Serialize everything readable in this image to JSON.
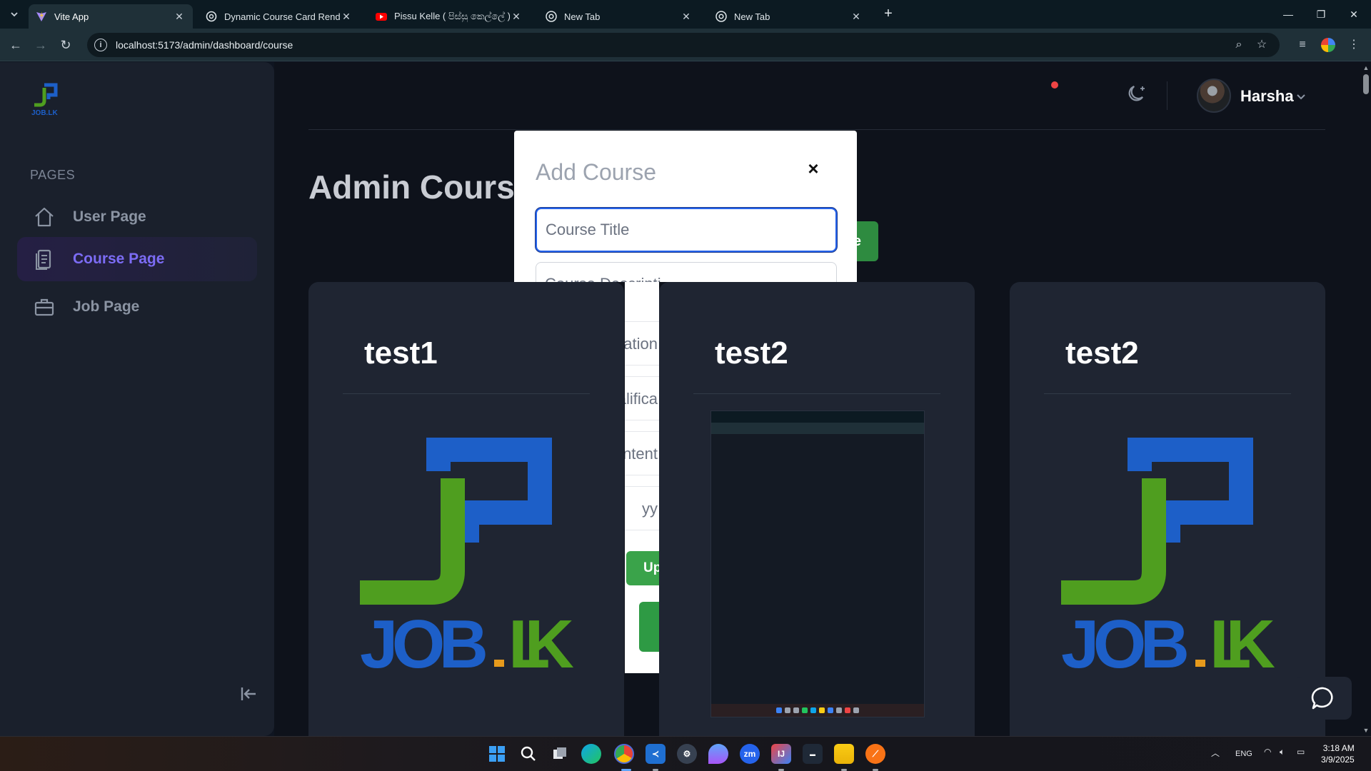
{
  "browser": {
    "tabs": [
      {
        "title": "Vite App",
        "icon": "vite-icon",
        "active": true
      },
      {
        "title": "Dynamic Course Card Renderin",
        "icon": "chatgpt-icon",
        "active": false
      },
      {
        "title": "Pissu Kelle ( පිස්සු කෙල්ලේ ) -",
        "icon": "youtube-icon",
        "active": false
      },
      {
        "title": "New Tab",
        "icon": "chrome-icon",
        "active": false
      },
      {
        "title": "New Tab",
        "icon": "chrome-icon",
        "active": false
      }
    ],
    "url": "localhost:5173/admin/dashboard/course",
    "new_tab_symbol": "+"
  },
  "sidebar": {
    "logo_text": "JOB.LK",
    "section_title": "PAGES",
    "items": [
      {
        "label": "User Page",
        "icon": "home-icon",
        "active": false
      },
      {
        "label": "Course Page",
        "icon": "document-icon",
        "active": true
      },
      {
        "label": "Job Page",
        "icon": "briefcase-icon",
        "active": false
      }
    ]
  },
  "header": {
    "user_name": "Harsha"
  },
  "main": {
    "page_title": "Admin Course",
    "add_button_label": "e",
    "cards": [
      {
        "title": "test1",
        "image": "joblk-logo"
      },
      {
        "title": "test2",
        "image": "screenshot"
      },
      {
        "title": "test2",
        "image": "joblk-logo"
      }
    ]
  },
  "modal": {
    "title": "Add Course",
    "close_symbol": "×",
    "fields": [
      {
        "placeholder": "Course Title"
      },
      {
        "placeholder": "Course Descripti"
      }
    ],
    "hidden_fields": [
      "ation",
      "alifica",
      "ntent",
      "yy"
    ],
    "upload_label": "Up"
  },
  "taskbar": {
    "language": "ENG",
    "time": "3:18 AM",
    "date": "3/9/2025"
  },
  "colors": {
    "accent_purple": "#7c6cf5",
    "primary_green": "#2e8b40",
    "focus_blue": "#2563eb",
    "notification_red": "#ef4444"
  }
}
